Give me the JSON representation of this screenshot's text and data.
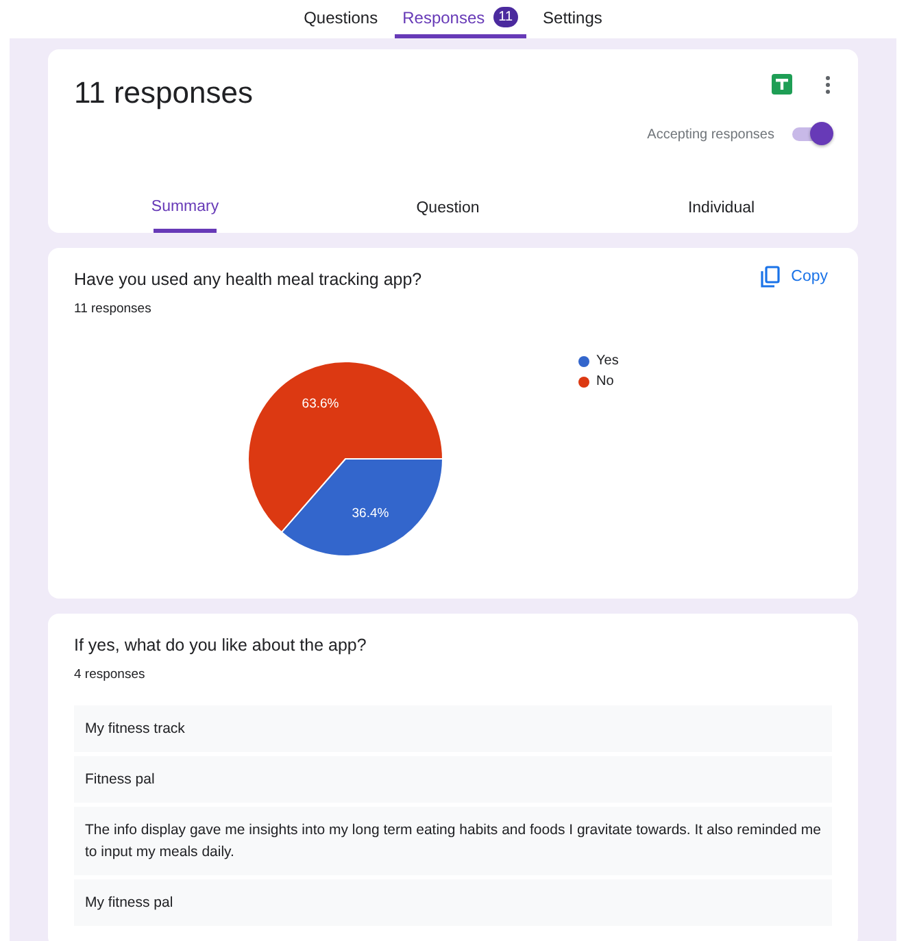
{
  "top_tabs": [
    {
      "label": "Questions",
      "selected": false
    },
    {
      "label": "Responses",
      "selected": true,
      "badge": "11"
    },
    {
      "label": "Settings",
      "selected": false
    }
  ],
  "header": {
    "title": "11 responses",
    "accepting": {
      "label": "Accepting responses",
      "on": true
    },
    "view_tabs": [
      {
        "label": "Summary",
        "selected": true
      },
      {
        "label": "Question",
        "selected": false
      },
      {
        "label": "Individual",
        "selected": false
      }
    ]
  },
  "questions": [
    {
      "kind": "chart",
      "title": "Have you used any health meal tracking app?",
      "count": "11 responses",
      "copy": "Copy",
      "chart_data": {
        "type": "pie",
        "categories": [
          "Yes",
          "No"
        ],
        "values": [
          36.4,
          63.6
        ],
        "legend": "right",
        "colors": [
          "#3366cc",
          "#dc3912"
        ],
        "value_labels": [
          "36.4%",
          "63.6%"
        ]
      }
    },
    {
      "kind": "text",
      "title": "If yes, what do you like about the app?",
      "count": "4 responses",
      "answers": [
        "My fitness track",
        "Fitness pal",
        "The info display gave me insights into my long term eating habits and foods I gravitate towards. It also reminded me to input my meals daily.",
        "My fitness pal"
      ]
    }
  ]
}
